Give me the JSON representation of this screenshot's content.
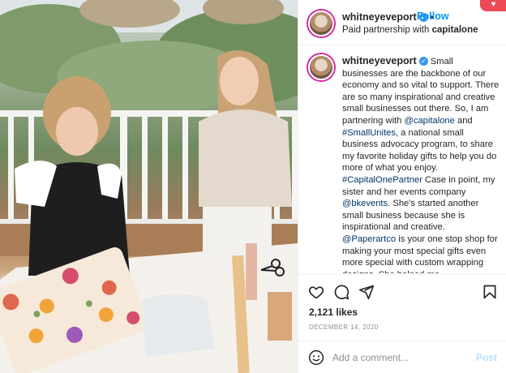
{
  "post": {
    "username": "whitneyeveport",
    "follow_label": "Follow",
    "dot": "•",
    "partnership_prefix": "Paid partnership with",
    "partner": "capitalone",
    "caption_segments": [
      {
        "text": "Small businesses are the backbone of our economy and so vital to support. There are so many inspirational and creative small businesses out there. So, I am partnering with ",
        "mention": false
      },
      {
        "text": "@capitalone",
        "mention": true
      },
      {
        "text": " and ",
        "mention": false
      },
      {
        "text": "#SmallUnites",
        "mention": true
      },
      {
        "text": ", a national small business advocacy program, to share my favorite holiday gifts to help you do more of what you enjoy. ",
        "mention": false
      },
      {
        "text": "#CapitalOnePartner",
        "mention": true
      },
      {
        "text": " Case in point, my sister and her events company ",
        "mention": false
      },
      {
        "text": "@bkevents",
        "mention": true
      },
      {
        "text": ". She's started another small business because she is inspirational and creative. ",
        "mention": false
      },
      {
        "text": "@Paperartco",
        "mention": true
      },
      {
        "text": " is your one stop shop for making your most special gifts even more special with custom wrapping designs. She helped me",
        "mention": false
      }
    ],
    "likes": "2,121 likes",
    "date": "DECEMBER 14, 2020"
  },
  "icons": {
    "like": "heart-icon",
    "comment": "comment-icon",
    "share": "share-icon",
    "save": "bookmark-icon",
    "emoji": "emoji-icon",
    "verified": "verified-badge-icon",
    "notification": "notification-heart-icon"
  },
  "comment_box": {
    "placeholder": "Add a comment...",
    "post_label": "Post"
  },
  "notification": {
    "glyph": "♥"
  },
  "verified_glyph": "✓",
  "colors": {
    "link": "#0095f6",
    "mention": "#00376b",
    "post_disabled": "#b2dffc",
    "notification": "#ed4956",
    "verified": "#3897f0"
  }
}
